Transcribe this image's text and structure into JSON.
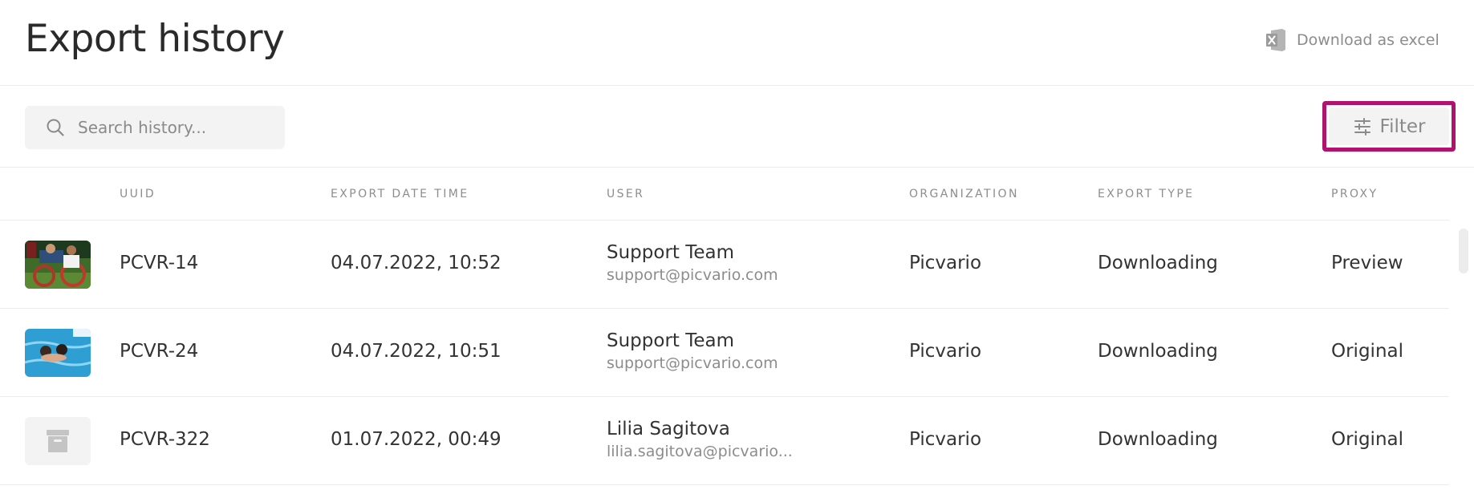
{
  "header": {
    "title": "Export history",
    "download_label": "Download as excel"
  },
  "toolbar": {
    "search_placeholder": "Search history...",
    "search_value": "",
    "filter_label": "Filter"
  },
  "table": {
    "columns": [
      "UUID",
      "EXPORT DATE TIME",
      "USER",
      "ORGANIZATION",
      "EXPORT TYPE",
      "PROXY"
    ],
    "rows": [
      {
        "thumb": "wheelchair-basketball-photo",
        "uuid": "PCVR-14",
        "datetime": "04.07.2022, 10:52",
        "user_name": "Support Team",
        "user_email": "support@picvario.com",
        "organization": "Picvario",
        "export_type": "Downloading",
        "proxy": "Preview"
      },
      {
        "thumb": "swimming-pool-photo",
        "uuid": "PCVR-24",
        "datetime": "04.07.2022, 10:51",
        "user_name": "Support Team",
        "user_email": "support@picvario.com",
        "organization": "Picvario",
        "export_type": "Downloading",
        "proxy": "Original"
      },
      {
        "thumb": "archive-icon",
        "uuid": "PCVR-322",
        "datetime": "01.07.2022, 00:49",
        "user_name": "Lilia Sagitova",
        "user_email": "lilia.sagitova@picvario...",
        "organization": "Picvario",
        "export_type": "Downloading",
        "proxy": "Original"
      }
    ]
  },
  "colors": {
    "highlight": "#b0136e",
    "muted_text": "#8c8c8c",
    "field_bg": "#f3f3f3"
  }
}
